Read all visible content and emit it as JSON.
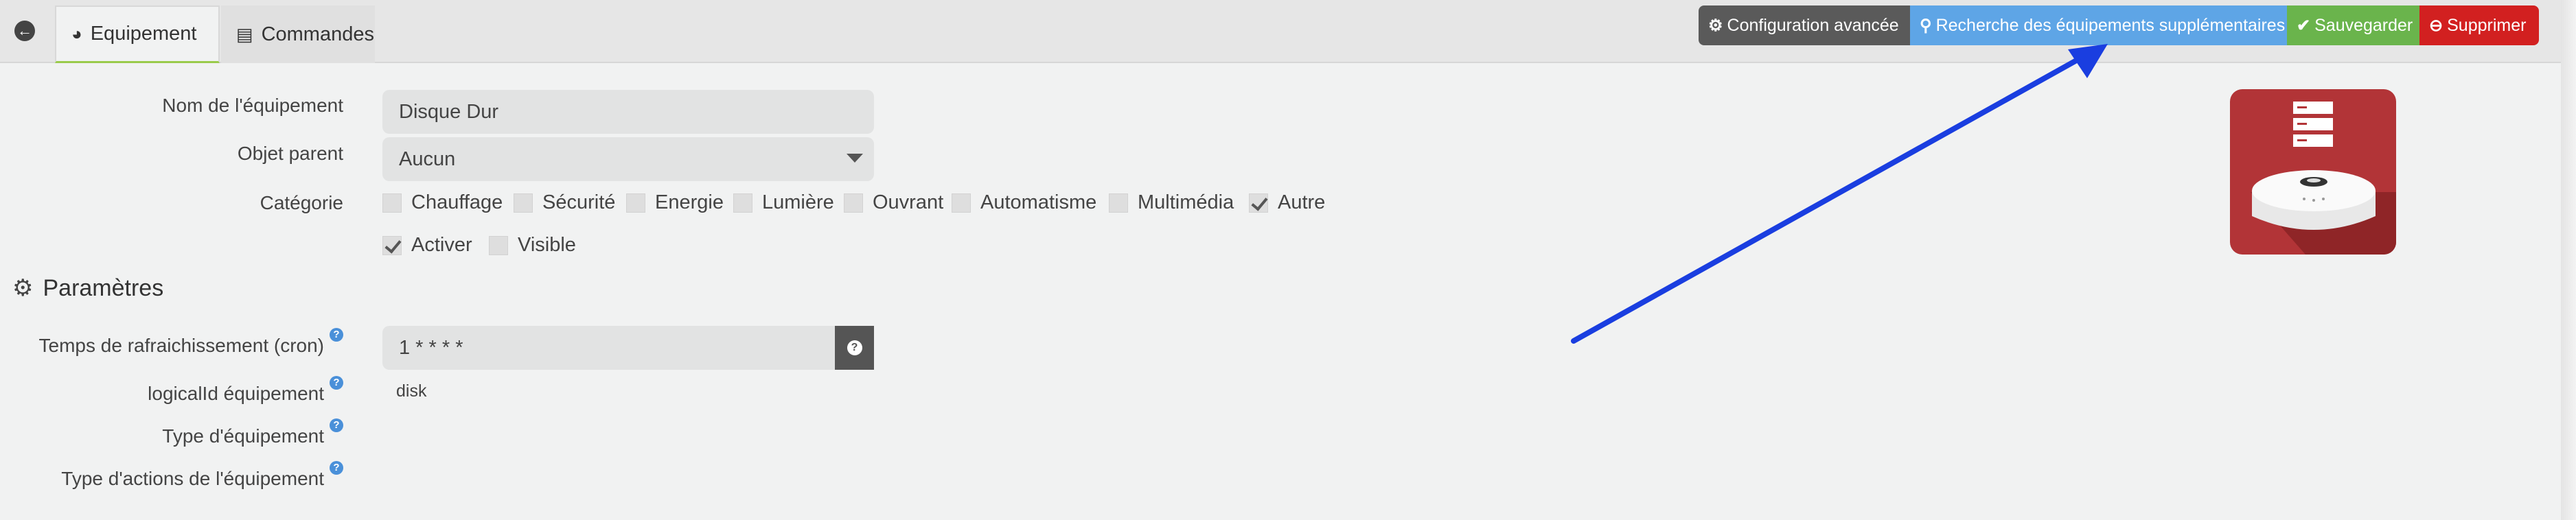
{
  "tabs": [
    {
      "label": "Equipement",
      "icon": "dashboard-icon",
      "active": true
    },
    {
      "label": "Commandes",
      "icon": "list-icon",
      "active": false
    }
  ],
  "actions": {
    "config": "Configuration avancée",
    "search": "Recherche des équipements supplémentaires",
    "save": "Sauvegarder",
    "delete": "Supprimer"
  },
  "form": {
    "name_label": "Nom de l'équipement",
    "name_value": "Disque Dur",
    "parent_label": "Objet parent",
    "parent_value": "Aucun",
    "category_label": "Catégorie",
    "categories": [
      {
        "label": "Chauffage",
        "checked": false
      },
      {
        "label": "Sécurité",
        "checked": false
      },
      {
        "label": "Energie",
        "checked": false
      },
      {
        "label": "Lumière",
        "checked": false
      },
      {
        "label": "Ouvrant",
        "checked": false
      },
      {
        "label": "Automatisme",
        "checked": false
      },
      {
        "label": "Multimédia",
        "checked": false
      },
      {
        "label": "Autre",
        "checked": true
      }
    ],
    "activate_label": "Activer",
    "activate_checked": true,
    "visible_label": "Visible",
    "visible_checked": false
  },
  "params": {
    "title": "Paramètres",
    "cron_label": "Temps de rafraichissement (cron)",
    "cron_value": "1 * * * *",
    "logical_label": "logicalId équipement",
    "logical_value": "disk",
    "type_label": "Type d'équipement",
    "action_type_label": "Type d'actions de l'équipement"
  },
  "colors": {
    "config": "#5a5a5a",
    "search": "#5ea5e6",
    "save": "#6ab44c",
    "delete": "#d22020",
    "icon_bg": "#b23437",
    "annotation_arrow": "#1a3ee0"
  }
}
